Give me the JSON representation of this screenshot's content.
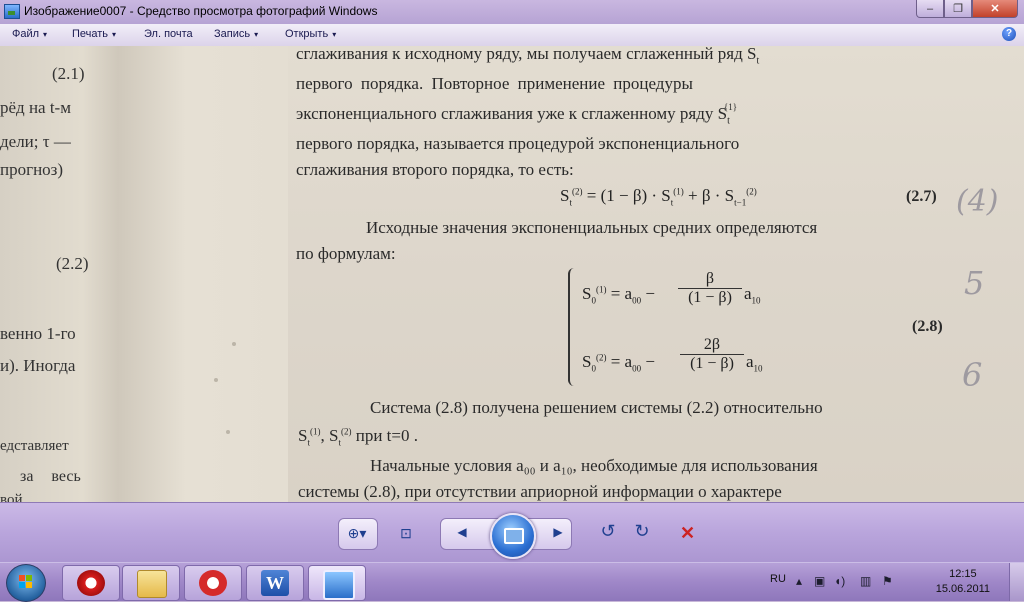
{
  "window": {
    "title": "Изображение0007 - Средство просмотра фотографий Windows",
    "minimize": "–",
    "restore": "❐",
    "close": "✕"
  },
  "menu": {
    "items": [
      {
        "label": "Файл",
        "arrow": "▾"
      },
      {
        "label": "Печать",
        "arrow": "▾"
      },
      {
        "label": "Эл. почта",
        "arrow": ""
      },
      {
        "label": "Запись",
        "arrow": "▾"
      },
      {
        "label": "Открыть",
        "arrow": "▾"
      }
    ],
    "help": "?"
  },
  "photo": {
    "left_page": [
      "(2.1)",
      "рёд на t-м",
      "дели;  τ —",
      "прогноз)",
      "(2.2)",
      "венно 1-го",
      "и).  Иногда",
      "едставляет",
      "за    весь",
      "вой"
    ],
    "lines": [
      "сглаживания к исходному ряду, мы получаем сглаженный ряд  S",
      "первого         порядка.    Повторное      применение      процедуры",
      "экспоненциального   сглаживания   уже   к   сглаженному   ряду   S",
      "первого    порядка,    называется    процедурой    экспоненциального",
      "сглаживания второго порядка, то есть:",
      "Исходные значения экспоненциальных средних определяются",
      "по формулам:",
      "Система (2.8) получена решением системы (2.2) относительно",
      "при t=0 .",
      "Начальные условия a₀₀ и a₁₀, необходимые для использования",
      "системы (2.8), при отсутствии априорной информации о характере"
    ],
    "eq_27": "S",
    "eq_27_rhs": "= (1 − β) · S",
    "eq_27_mid": "+ β · S",
    "eq_27_no": "(2.7)",
    "eq_28_top": "S",
    "eq_28_top_rhs": "= a",
    "eq_28_top_frac_num": "β",
    "eq_28_top_frac_den": "(1 − β)",
    "eq_28_top_tail": "a",
    "eq_28_bot_frac_num": "2β",
    "eq_28_bot_frac_den": "(1 − β)",
    "eq_28_no": "(2.8)",
    "s_pair": "S",
    "margin_notes": [
      "(4)",
      "5",
      "6"
    ]
  },
  "viewer_toolbar": {
    "zoom": "⊕▾",
    "fit": "⊡",
    "prev": "◀",
    "next": "▶",
    "rot_left": "↺",
    "rot_right": "↻",
    "delete": "✕"
  },
  "taskbar": {
    "tray_lang": "RU",
    "time": "12:15",
    "date": "15.06.2011"
  }
}
